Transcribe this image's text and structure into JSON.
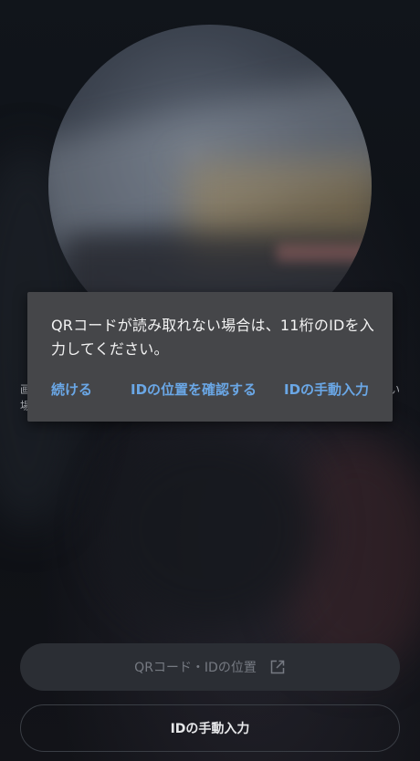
{
  "scan_hint": {
    "line1_fragment_left": "画",
    "line2_fragment_left": "場",
    "line1_fragment_right": "い"
  },
  "dialog": {
    "message": "QRコードが読み取れない場合は、11桁のIDを入力してください。",
    "actions": {
      "continue": "続ける",
      "check_location": "IDの位置を確認する",
      "manual_entry": "IDの手動入力"
    },
    "accent_color": "#6aa7e6"
  },
  "bottom": {
    "location_button": "QRコード・IDの位置",
    "manual_button": "IDの手動入力",
    "location_icon": "external-link-icon"
  }
}
